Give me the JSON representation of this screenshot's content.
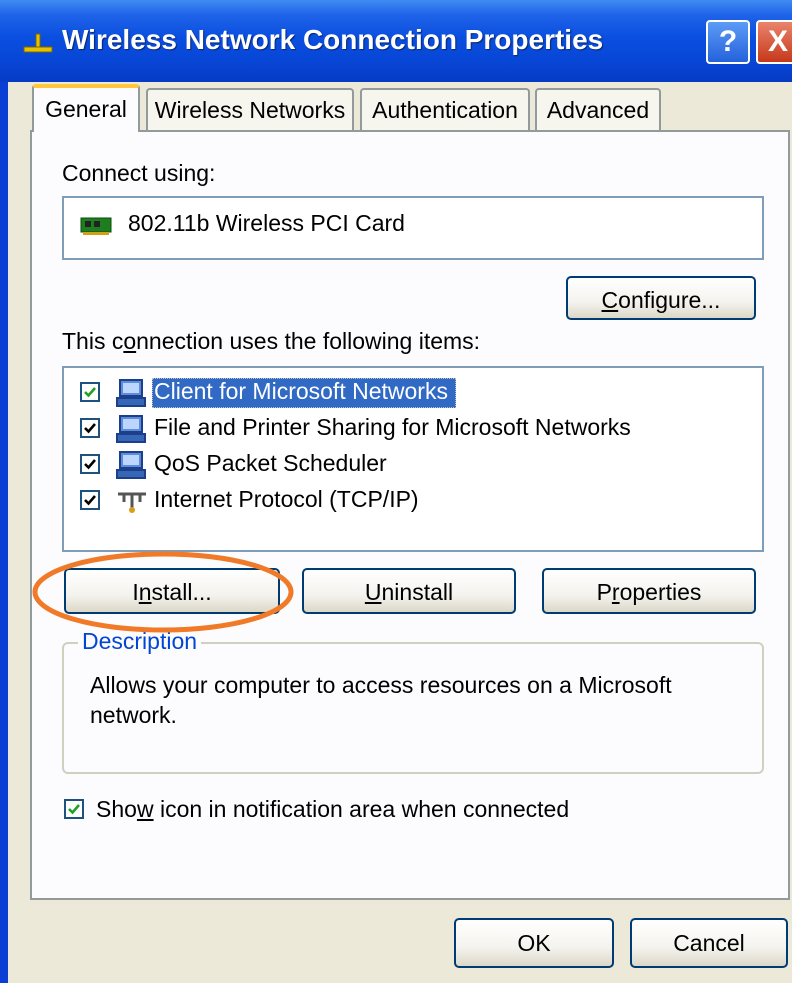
{
  "window": {
    "title": "Wireless Network Connection Properties",
    "help_glyph": "?",
    "close_glyph": "X"
  },
  "tabs": [
    {
      "label": "General",
      "active": true
    },
    {
      "label": "Wireless Networks",
      "active": false
    },
    {
      "label": "Authentication",
      "active": false
    },
    {
      "label": "Advanced",
      "active": false
    }
  ],
  "general": {
    "connect_using_label": "Connect using:",
    "adapter_name": "802.11b Wireless PCI Card",
    "configure": {
      "pre": "",
      "key": "C",
      "post": "onfigure..."
    },
    "items_label": {
      "pre": "This c",
      "key": "o",
      "post": "nnection uses the following items:"
    },
    "items": [
      {
        "label": "Client for Microsoft Networks",
        "checked": true,
        "selected": true,
        "icon": "network-client-icon"
      },
      {
        "label": "File and Printer Sharing for Microsoft Networks",
        "checked": true,
        "selected": false,
        "icon": "network-service-icon"
      },
      {
        "label": "QoS Packet Scheduler",
        "checked": true,
        "selected": false,
        "icon": "network-service-icon"
      },
      {
        "label": "Internet Protocol (TCP/IP)",
        "checked": true,
        "selected": false,
        "icon": "protocol-icon"
      }
    ],
    "install": {
      "pre": "I",
      "key": "n",
      "post": "stall..."
    },
    "uninstall": {
      "pre": "",
      "key": "U",
      "post": "ninstall"
    },
    "properties": {
      "pre": "P",
      "key": "r",
      "post": "operties"
    },
    "description_title": "Description",
    "description_text": "Allows your computer to access resources on a Microsoft network.",
    "show_icon": {
      "pre": "Sho",
      "key": "w",
      "post": " icon in notification area when connected",
      "checked": true
    }
  },
  "footer": {
    "ok": "OK",
    "cancel": "Cancel"
  },
  "colors": {
    "titlebar": "#0846d6",
    "dialog_face": "#ece9d8",
    "selection": "#316ac5",
    "annotation_circle": "#f07a28"
  }
}
